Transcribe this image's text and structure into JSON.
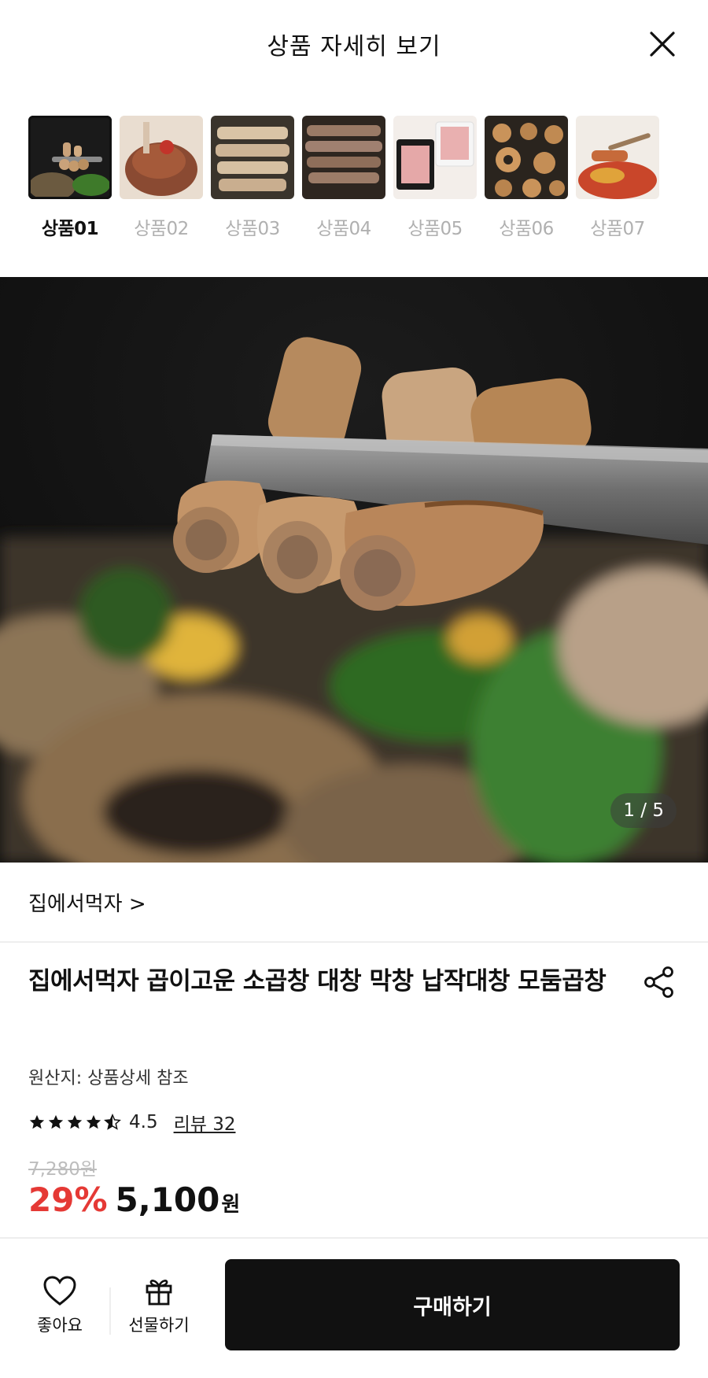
{
  "header": {
    "title": "상품 자세히 보기"
  },
  "thumbnails": [
    {
      "label": "상품01",
      "active": true
    },
    {
      "label": "상품02",
      "active": false
    },
    {
      "label": "상품03",
      "active": false
    },
    {
      "label": "상품04",
      "active": false
    },
    {
      "label": "상품05",
      "active": false
    },
    {
      "label": "상품06",
      "active": false
    },
    {
      "label": "상품07",
      "active": false
    }
  ],
  "hero": {
    "pager": "1 / 5"
  },
  "store": {
    "name": "집에서먹자 >"
  },
  "product": {
    "name": "집에서먹자 곱이고운 소곱창 대창 막창 납작대창 모둠곱창",
    "origin": "원산지: 상품상세 참조",
    "rating": "4.5",
    "rating_stars": 4.5,
    "review": "리뷰 32",
    "original_price": "7,280원",
    "discount": "29%",
    "price": "5,100",
    "currency": "원"
  },
  "bottom": {
    "like_label": "좋아요",
    "gift_label": "선물하기",
    "buy_label": "구매하기"
  },
  "colors": {
    "accent_red": "#e53935",
    "button_dark": "#111111",
    "muted": "#b0b0b0"
  }
}
